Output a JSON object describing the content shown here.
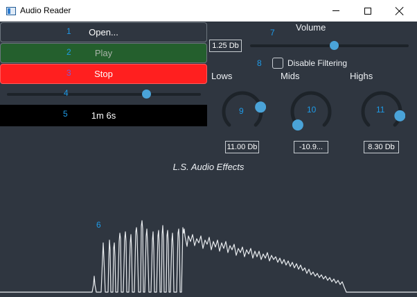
{
  "window": {
    "title": "Audio Reader",
    "minimize_icon": "minimize-icon",
    "maximize_icon": "maximize-icon",
    "close_icon": "close-icon"
  },
  "buttons": {
    "open": "Open...",
    "play": "Play",
    "stop": "Stop"
  },
  "markers": {
    "m1": "1",
    "m2": "2",
    "m3": "3",
    "m4": "4",
    "m5": "5",
    "m6": "6",
    "m7": "7",
    "m8": "8",
    "m9": "9",
    "m10": "10",
    "m11": "11"
  },
  "position": {
    "fraction": 0.72
  },
  "time": "1m 6s",
  "volume": {
    "label": "Volume",
    "value": "1.25 Db",
    "fraction": 0.53
  },
  "filter": {
    "label": "Disable Filtering",
    "checked": false
  },
  "eq": {
    "lows": {
      "label": "Lows",
      "value": "11.00 Db",
      "level": 0.78
    },
    "mids": {
      "label": "Mids",
      "value": "-10.9...",
      "level": 0.0
    },
    "highs": {
      "label": "Highs",
      "value": "8.30 Db",
      "level": 0.88
    }
  },
  "effects_title": "L.S. Audio Effects",
  "colors": {
    "background": "#2f3640",
    "accent": "#4aa3d8",
    "marker": "#1e9be8",
    "play": "#245f2d",
    "stop": "#ff1f1f",
    "waveform": "#e9ecef"
  }
}
